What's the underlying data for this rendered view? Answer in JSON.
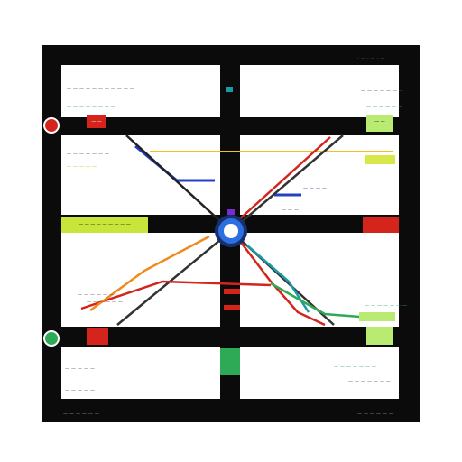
{
  "top_right_caption": "- — - — - —",
  "bottom_left_caption": "— — — — — —",
  "bottom_right_caption": "— — — — — —",
  "panels": {
    "top_left": {
      "line1": "— — — — — — — — — — —",
      "line2": "— — — — — — — —",
      "badge": "— —"
    },
    "top_right": {
      "line1": "— — — — — — —",
      "line2": "— — — — — —",
      "badge": "— —"
    },
    "mid_left": {
      "line1": "— — — — — — —",
      "line2": "— — — — —",
      "banner": "— — — — — — — — —"
    },
    "mid_right": {
      "line1": "— — — — — — —",
      "line2": "— — — —",
      "badge": "— — —"
    },
    "low_left": {
      "line1": "— — — — — —",
      "line2": "— — — — — —"
    },
    "low_right": {
      "line1": "— — — — — — —",
      "line2": "— — — — — — —"
    },
    "bottom_left": {
      "line1": "— — — — — —",
      "line2": "— — — — —",
      "line3": "— — — — —"
    },
    "bottom_right": {
      "line1": "— — — — — — —",
      "line2": "— — — — — — —"
    }
  },
  "colors": {
    "red": "#d4241c",
    "green": "#2eaa57",
    "yellow": "#c8e63a",
    "blue": "#2340c8",
    "orange": "#f08a1c",
    "teal": "#1b9aa6"
  },
  "icons": {
    "hub": "compass-hub-icon",
    "left_top_dot": "record-dot-icon",
    "left_bottom_dot": "green-dot-icon"
  }
}
